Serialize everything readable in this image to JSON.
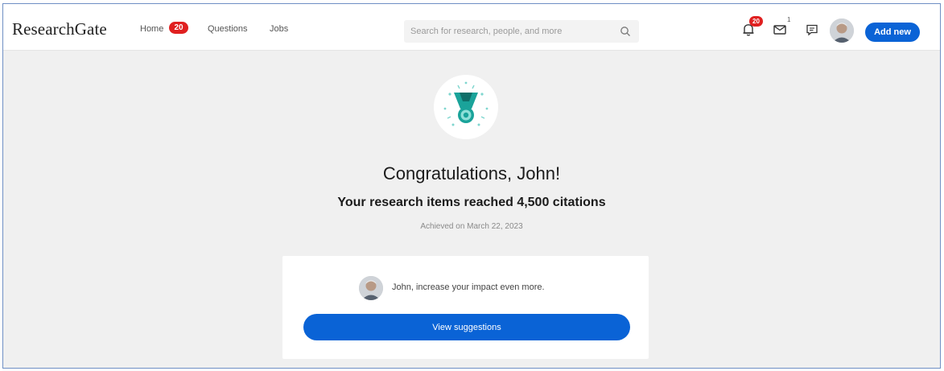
{
  "header": {
    "logo": "ResearchGate",
    "nav": {
      "home_label": "Home",
      "home_badge": "20",
      "questions_label": "Questions",
      "jobs_label": "Jobs"
    },
    "search_placeholder": "Search for research, people, and more",
    "notifications_badge": "20",
    "messages_badge": "1",
    "add_new_label": "Add new"
  },
  "main": {
    "title": "Congratulations, John!",
    "subtitle": "Your research items reached 4,500 citations",
    "achieved": "Achieved on March 22, 2023",
    "card": {
      "text": "John, increase your impact even more.",
      "button_label": "View suggestions"
    }
  },
  "colors": {
    "accent": "#0a63d6",
    "badge": "#e02020",
    "medal": "#1aa39a",
    "background": "#f0f0f0"
  },
  "icons": [
    "search-icon",
    "bell-icon",
    "mail-icon",
    "chat-icon",
    "medal-icon",
    "avatar"
  ]
}
